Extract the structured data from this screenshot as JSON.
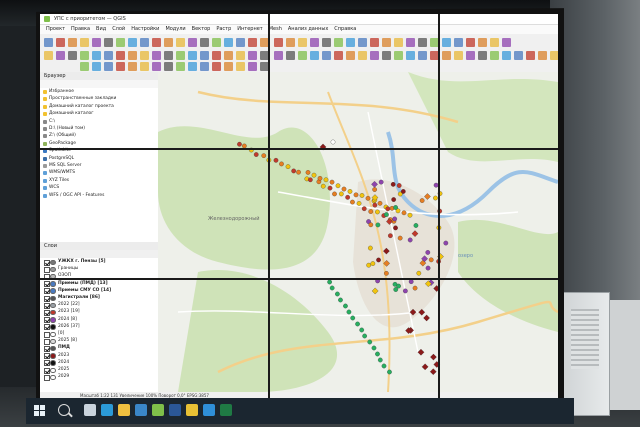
{
  "window": {
    "title": "УПС с приоритетом — QGIS"
  },
  "menu": [
    "Проект",
    "Правка",
    "Вид",
    "Слой",
    "Настройки",
    "Модули",
    "Вектор",
    "Растр",
    "Интернет",
    "Mesh",
    "Анализ данных",
    "Справка"
  ],
  "browser": {
    "title": "Браузер",
    "items": [
      {
        "label": "Избранное",
        "icon_color": "#f2c230"
      },
      {
        "label": "Пространственные закладки",
        "icon_color": "#f2c230"
      },
      {
        "label": "Домашний каталог проекта",
        "icon_color": "#f2c230"
      },
      {
        "label": "Домашний каталог",
        "icon_color": "#f2c230"
      },
      {
        "label": "C:\\",
        "icon_color": "#888888"
      },
      {
        "label": "D:\\ (Новый том)",
        "icon_color": "#888888"
      },
      {
        "label": "Z:\\ (Общий)",
        "icon_color": "#888888"
      },
      {
        "label": "GeoPackage",
        "icon_color": "#8fb35a"
      },
      {
        "label": "SpatiaLite",
        "icon_color": "#3b79c2"
      },
      {
        "label": "PostgreSQL",
        "icon_color": "#3b6ea8"
      },
      {
        "label": "MS SQL Server",
        "icon_color": "#9a9a9a"
      },
      {
        "label": "WMS/WMTS",
        "icon_color": "#5fa0d8"
      },
      {
        "label": "XYZ Tiles",
        "icon_color": "#5fa0d8"
      },
      {
        "label": "WCS",
        "icon_color": "#5fa0d8"
      },
      {
        "label": "WFS / OGC API - Features",
        "icon_color": "#5fa0d8"
      }
    ]
  },
  "layers": {
    "title": "Слои",
    "items": [
      {
        "label": "УЖКХ г. Пензы [5]",
        "checked": true,
        "bold": true,
        "symbol": "#777777"
      },
      {
        "label": "Границы",
        "checked": false,
        "bold": false,
        "symbol": "#999999"
      },
      {
        "label": "ОЗОП",
        "checked": false,
        "bold": false,
        "symbol": "#bbbbbb"
      },
      {
        "label": "Приемы (ПМД) [13]",
        "checked": true,
        "bold": true,
        "symbol": "#4a7abf"
      },
      {
        "label": "Приемы СМУ СО [14]",
        "checked": true,
        "bold": true,
        "symbol": "#4a7abf"
      },
      {
        "label": "Магистрали [86]",
        "checked": true,
        "bold": true,
        "symbol": "#555555"
      },
      {
        "label": "2022 [22]",
        "checked": true,
        "bold": false,
        "symbol": "#9aa0a6"
      },
      {
        "label": "2023 [19]",
        "checked": true,
        "bold": false,
        "symbol": "#c0392b"
      },
      {
        "label": "2024 [8]",
        "checked": true,
        "bold": false,
        "symbol": "#8e44ad"
      },
      {
        "label": "2026 [37]",
        "checked": true,
        "bold": false,
        "symbol": "#111111"
      },
      {
        "label": "[0]",
        "checked": false,
        "bold": false,
        "symbol": "#ffffff"
      },
      {
        "label": "2025 [8]",
        "checked": false,
        "bold": false,
        "symbol": "#dddddd"
      },
      {
        "label": "ПМД",
        "checked": true,
        "bold": true,
        "symbol": "#555555"
      },
      {
        "label": "2023",
        "checked": true,
        "bold": false,
        "symbol": "#8b1a1a"
      },
      {
        "label": "2024",
        "checked": true,
        "bold": false,
        "symbol": "#111111"
      },
      {
        "label": "2025",
        "checked": true,
        "bold": false,
        "symbol": "#ffffff"
      },
      {
        "label": "2029",
        "checked": false,
        "bold": false,
        "symbol": "#ffffff"
      }
    ]
  },
  "map": {
    "lake_label": "озеро",
    "district_label": "Железнодорожный"
  },
  "status": {
    "coordinate_text": "Масштаб 1:22 131   Увеличение 100%   Поворот 0,0°   EPSG:3857"
  },
  "taskbar": {
    "icons": [
      {
        "name": "task-view-icon",
        "color": "#c9d3dc"
      },
      {
        "name": "edge-icon",
        "color": "#2b9ad8"
      },
      {
        "name": "file-explorer-icon",
        "color": "#f0c040"
      },
      {
        "name": "store-icon",
        "color": "#3a86c8"
      },
      {
        "name": "qgis-icon",
        "color": "#7fbf4a"
      },
      {
        "name": "word-icon",
        "color": "#2b5797"
      },
      {
        "name": "chrome-icon",
        "color": "#e8c035"
      },
      {
        "name": "mail-icon",
        "color": "#2f8fd8"
      },
      {
        "name": "excel-icon",
        "color": "#1f7a44"
      }
    ]
  }
}
